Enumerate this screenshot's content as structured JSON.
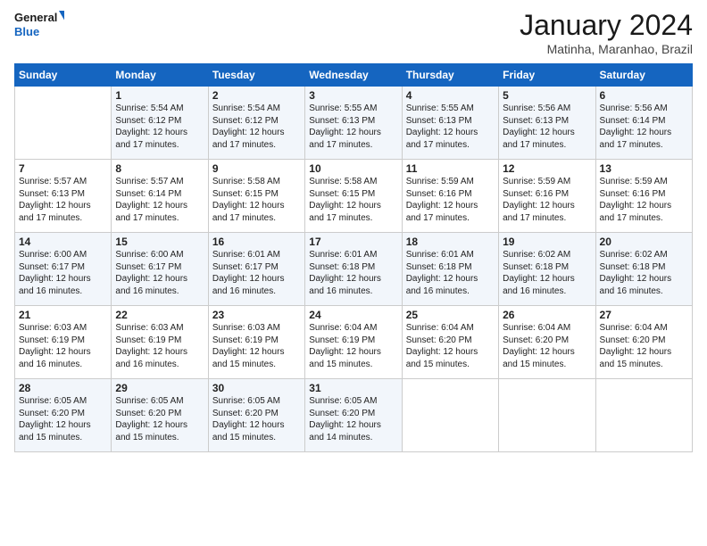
{
  "logo": {
    "line1": "General",
    "line2": "Blue"
  },
  "title": "January 2024",
  "subtitle": "Matinha, Maranhao, Brazil",
  "days_header": [
    "Sunday",
    "Monday",
    "Tuesday",
    "Wednesday",
    "Thursday",
    "Friday",
    "Saturday"
  ],
  "weeks": [
    [
      {
        "day": "",
        "info": ""
      },
      {
        "day": "1",
        "info": "Sunrise: 5:54 AM\nSunset: 6:12 PM\nDaylight: 12 hours\nand 17 minutes."
      },
      {
        "day": "2",
        "info": "Sunrise: 5:54 AM\nSunset: 6:12 PM\nDaylight: 12 hours\nand 17 minutes."
      },
      {
        "day": "3",
        "info": "Sunrise: 5:55 AM\nSunset: 6:13 PM\nDaylight: 12 hours\nand 17 minutes."
      },
      {
        "day": "4",
        "info": "Sunrise: 5:55 AM\nSunset: 6:13 PM\nDaylight: 12 hours\nand 17 minutes."
      },
      {
        "day": "5",
        "info": "Sunrise: 5:56 AM\nSunset: 6:13 PM\nDaylight: 12 hours\nand 17 minutes."
      },
      {
        "day": "6",
        "info": "Sunrise: 5:56 AM\nSunset: 6:14 PM\nDaylight: 12 hours\nand 17 minutes."
      }
    ],
    [
      {
        "day": "7",
        "info": "Sunrise: 5:57 AM\nSunset: 6:13 PM\nDaylight: 12 hours\nand 17 minutes."
      },
      {
        "day": "8",
        "info": "Sunrise: 5:57 AM\nSunset: 6:14 PM\nDaylight: 12 hours\nand 17 minutes."
      },
      {
        "day": "9",
        "info": "Sunrise: 5:58 AM\nSunset: 6:15 PM\nDaylight: 12 hours\nand 17 minutes."
      },
      {
        "day": "10",
        "info": "Sunrise: 5:58 AM\nSunset: 6:15 PM\nDaylight: 12 hours\nand 17 minutes."
      },
      {
        "day": "11",
        "info": "Sunrise: 5:59 AM\nSunset: 6:16 PM\nDaylight: 12 hours\nand 17 minutes."
      },
      {
        "day": "12",
        "info": "Sunrise: 5:59 AM\nSunset: 6:16 PM\nDaylight: 12 hours\nand 17 minutes."
      },
      {
        "day": "13",
        "info": "Sunrise: 5:59 AM\nSunset: 6:16 PM\nDaylight: 12 hours\nand 17 minutes."
      }
    ],
    [
      {
        "day": "14",
        "info": "Sunrise: 6:00 AM\nSunset: 6:17 PM\nDaylight: 12 hours\nand 16 minutes."
      },
      {
        "day": "15",
        "info": "Sunrise: 6:00 AM\nSunset: 6:17 PM\nDaylight: 12 hours\nand 16 minutes."
      },
      {
        "day": "16",
        "info": "Sunrise: 6:01 AM\nSunset: 6:17 PM\nDaylight: 12 hours\nand 16 minutes."
      },
      {
        "day": "17",
        "info": "Sunrise: 6:01 AM\nSunset: 6:18 PM\nDaylight: 12 hours\nand 16 minutes."
      },
      {
        "day": "18",
        "info": "Sunrise: 6:01 AM\nSunset: 6:18 PM\nDaylight: 12 hours\nand 16 minutes."
      },
      {
        "day": "19",
        "info": "Sunrise: 6:02 AM\nSunset: 6:18 PM\nDaylight: 12 hours\nand 16 minutes."
      },
      {
        "day": "20",
        "info": "Sunrise: 6:02 AM\nSunset: 6:18 PM\nDaylight: 12 hours\nand 16 minutes."
      }
    ],
    [
      {
        "day": "21",
        "info": "Sunrise: 6:03 AM\nSunset: 6:19 PM\nDaylight: 12 hours\nand 16 minutes."
      },
      {
        "day": "22",
        "info": "Sunrise: 6:03 AM\nSunset: 6:19 PM\nDaylight: 12 hours\nand 16 minutes."
      },
      {
        "day": "23",
        "info": "Sunrise: 6:03 AM\nSunset: 6:19 PM\nDaylight: 12 hours\nand 15 minutes."
      },
      {
        "day": "24",
        "info": "Sunrise: 6:04 AM\nSunset: 6:19 PM\nDaylight: 12 hours\nand 15 minutes."
      },
      {
        "day": "25",
        "info": "Sunrise: 6:04 AM\nSunset: 6:20 PM\nDaylight: 12 hours\nand 15 minutes."
      },
      {
        "day": "26",
        "info": "Sunrise: 6:04 AM\nSunset: 6:20 PM\nDaylight: 12 hours\nand 15 minutes."
      },
      {
        "day": "27",
        "info": "Sunrise: 6:04 AM\nSunset: 6:20 PM\nDaylight: 12 hours\nand 15 minutes."
      }
    ],
    [
      {
        "day": "28",
        "info": "Sunrise: 6:05 AM\nSunset: 6:20 PM\nDaylight: 12 hours\nand 15 minutes."
      },
      {
        "day": "29",
        "info": "Sunrise: 6:05 AM\nSunset: 6:20 PM\nDaylight: 12 hours\nand 15 minutes."
      },
      {
        "day": "30",
        "info": "Sunrise: 6:05 AM\nSunset: 6:20 PM\nDaylight: 12 hours\nand 15 minutes."
      },
      {
        "day": "31",
        "info": "Sunrise: 6:05 AM\nSunset: 6:20 PM\nDaylight: 12 hours\nand 14 minutes."
      },
      {
        "day": "",
        "info": ""
      },
      {
        "day": "",
        "info": ""
      },
      {
        "day": "",
        "info": ""
      }
    ]
  ]
}
